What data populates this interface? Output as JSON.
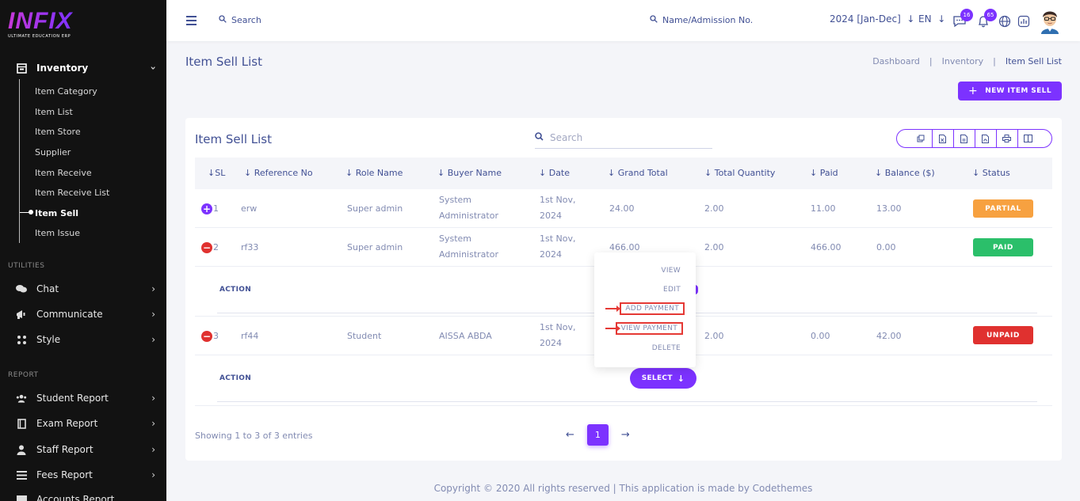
{
  "logo": {
    "text": "INFIX",
    "tagline": "ULTIMATE EDUCATION ERP"
  },
  "sidebar": {
    "inventory_label": "Inventory",
    "sub_items": [
      "Item Category",
      "Item List",
      "Item Store",
      "Supplier",
      "Item Receive",
      "Item Receive List",
      "Item Sell",
      "Item Issue"
    ],
    "active_sub": "Item Sell",
    "utilities_label": "UTILITIES",
    "utilities": [
      "Chat",
      "Communicate",
      "Style"
    ],
    "report_label": "REPORT",
    "reports": [
      "Student Report",
      "Exam Report",
      "Staff Report",
      "Fees Report",
      "Accounts Report"
    ]
  },
  "header": {
    "search_placeholder": "Search",
    "search2_placeholder": "Name/Admission No.",
    "session": "2024 [Jan-Dec]",
    "language": "EN",
    "messages_count": "16",
    "notifications_count": "65"
  },
  "page": {
    "title": "Item Sell List",
    "breadcrumb": [
      "Dashboard",
      "Inventory",
      "Item Sell List"
    ],
    "new_button": "NEW ITEM SELL"
  },
  "table": {
    "title": "Item Sell List",
    "search_placeholder": "Search",
    "columns": [
      "SL",
      "Reference No",
      "Role Name",
      "Buyer Name",
      "Date",
      "Grand Total",
      "Total Quantity",
      "Paid",
      "Balance ($)",
      "Status"
    ],
    "rows": [
      {
        "sl": "1",
        "ref": "erw",
        "role": "Super admin",
        "buyer1": "System",
        "buyer2": "Administrator",
        "date1": "1st Nov,",
        "date2": "2024",
        "total": "24.00",
        "qty": "2.00",
        "paid": "11.00",
        "balance": "13.00",
        "status": "PARTIAL"
      },
      {
        "sl": "2",
        "ref": "rf33",
        "role": "Super admin",
        "buyer1": "System",
        "buyer2": "Administrator",
        "date1": "1st Nov,",
        "date2": "2024",
        "total": "466.00",
        "qty": "2.00",
        "paid": "466.00",
        "balance": "0.00",
        "status": "PAID"
      },
      {
        "sl": "3",
        "ref": "rf44",
        "role": "Student",
        "buyer1": "AISSA ABDA",
        "buyer2": "",
        "date1": "1st Nov,",
        "date2": "2024",
        "total": "",
        "qty": "2.00",
        "paid": "0.00",
        "balance": "42.00",
        "status": "UNPAID"
      }
    ],
    "action_label": "ACTION",
    "menu": [
      "VIEW",
      "EDIT",
      "ADD PAYMENT",
      "VIEW PAYMENT",
      "DELETE"
    ],
    "select_label": "SELECT",
    "showing": "Showing 1 to 3 of 3 entries",
    "page": "1"
  },
  "colors": {
    "primary": "#7c32ff",
    "partial": "#f7a140",
    "paid": "#2bbf6a",
    "unpaid": "#e0312f",
    "sidebar": "#121212"
  },
  "footer": "Copyright © 2020 All rights reserved | This application is made by Codethemes"
}
